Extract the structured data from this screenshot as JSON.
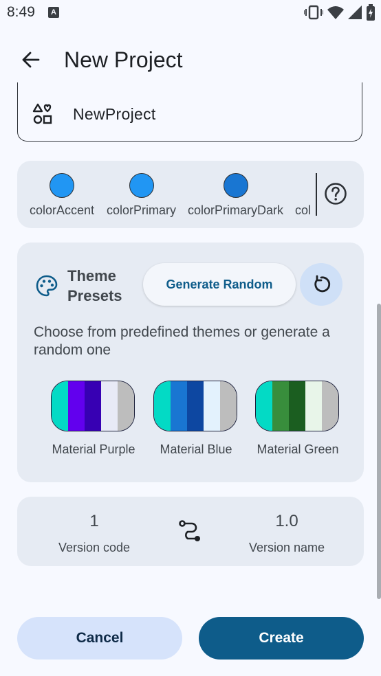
{
  "status": {
    "time": "8:49",
    "notification_glyph": "A"
  },
  "header": {
    "title": "New Project",
    "back_icon": "arrow-back-icon"
  },
  "project_name": {
    "value": "NewProject",
    "icon": "category-icon"
  },
  "colors": {
    "items": [
      {
        "label": "colorAccent",
        "color": "#2196F3"
      },
      {
        "label": "colorPrimary",
        "color": "#2196F3"
      },
      {
        "label": "colorPrimaryDark",
        "color": "#1976D2"
      },
      {
        "label": "col",
        "color": "#2196F3"
      }
    ],
    "help_icon": "help-icon"
  },
  "theme": {
    "title": "Theme Presets",
    "generate_label": "Generate Random",
    "description": "Choose from predefined themes or generate a random one",
    "presets": [
      {
        "label": "Material Purple",
        "colors": [
          "#03DAC5",
          "#6200EE",
          "#3700B3",
          "#E8EAF6",
          "#BDBDBD"
        ]
      },
      {
        "label": "Material Blue",
        "colors": [
          "#03DAC5",
          "#1976D2",
          "#0D47A1",
          "#E3F2FD",
          "#BDBDBD"
        ]
      },
      {
        "label": "Material Green",
        "colors": [
          "#03DAC5",
          "#388E3C",
          "#1B5E20",
          "#E8F5E9",
          "#BDBDBD"
        ]
      }
    ]
  },
  "version": {
    "code": "1",
    "code_label": "Version code",
    "name": "1.0",
    "name_label": "Version name"
  },
  "actions": {
    "cancel": "Cancel",
    "create": "Create"
  },
  "accent": {
    "primary": "#0E5C8A",
    "secondary_container": "#D6E3FB",
    "surface_variant": "#E6EBF3"
  }
}
